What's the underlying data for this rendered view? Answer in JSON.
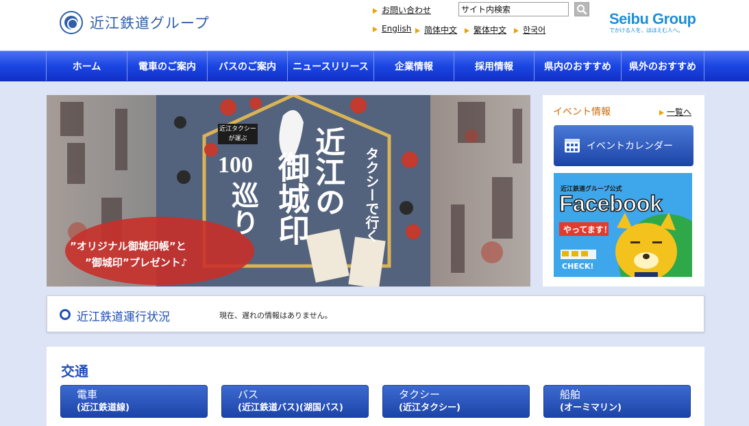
{
  "header": {
    "logo_text": "近江鉄道グループ",
    "contact_link": "お問い合わせ",
    "search_value": "サイト内検索",
    "languages": [
      "English",
      "简体中文",
      "繁体中文",
      "한국어"
    ],
    "seibu": {
      "title": "Seibu Group",
      "subtitle": "でかける人を、ほほえむ人へ。"
    }
  },
  "nav": {
    "items": [
      "ホーム",
      "電車のご案内",
      "バスのご案内",
      "ニュースリリース",
      "企業情報",
      "採用情報",
      "県内のおすすめ",
      "県外のおすすめ"
    ]
  },
  "banner": {
    "catch_line1": "タクシーで行く",
    "title_main": "近江の",
    "title_sub": "御城印",
    "title_num": "100",
    "title_meguri": "巡り",
    "tag_taxi": "近江タクシー",
    "tag_ga": "が運ぶ",
    "present_line1": "”オリジナル御城印帳”と",
    "present_line2": "”御城印”プレゼント♪"
  },
  "event": {
    "title": "イベント情報",
    "all_link": "一覧へ",
    "calendar_button": "イベントカレンダー",
    "fb": {
      "top": "近江鉄道グループ公式",
      "brand": "Facebook",
      "ribbon": "やってます！",
      "check": "CHECK!"
    }
  },
  "status": {
    "title": "近江鉄道運行状況",
    "message": "現在、遅れの情報はありません。"
  },
  "transport": {
    "title": "交通",
    "buttons": [
      {
        "l1": "電車",
        "l2": "(近江鉄道線)"
      },
      {
        "l1": "バス",
        "l2": "(近江鉄道バス)(湖国バス)"
      },
      {
        "l1": "タクシー",
        "l2": "(近江タクシー)"
      },
      {
        "l1": "船舶",
        "l2": "(オーミマリン)"
      }
    ]
  },
  "colors": {
    "accent": "#1f4fb6",
    "nav": "#1b46e2",
    "link_arrow": "#f0a000",
    "event_title": "#d46a00"
  }
}
